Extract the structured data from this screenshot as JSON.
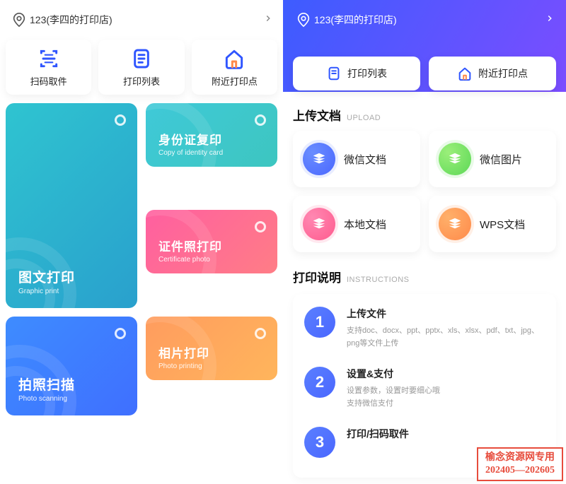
{
  "location": {
    "text": "123(李四的打印店)"
  },
  "left": {
    "actions": [
      {
        "label": "扫码取件"
      },
      {
        "label": "打印列表"
      },
      {
        "label": "附近打印点"
      }
    ],
    "tiles": {
      "graphic": {
        "title": "图文打印",
        "en": "Graphic print"
      },
      "id": {
        "title": "身份证复印",
        "en": "Copy of identity card"
      },
      "cert": {
        "title": "证件照打印",
        "en": "Certificate photo"
      },
      "scan": {
        "title": "拍照扫描",
        "en": "Photo scanning"
      },
      "photo": {
        "title": "相片打印",
        "en": "Photo printing"
      }
    }
  },
  "right": {
    "actions": [
      {
        "label": "打印列表"
      },
      {
        "label": "附近打印点"
      }
    ],
    "upload": {
      "heading_cn": "上传文档",
      "heading_en": "UPLOAD",
      "items": [
        {
          "label": "微信文档"
        },
        {
          "label": "微信图片"
        },
        {
          "label": "本地文档"
        },
        {
          "label": "WPS文档"
        }
      ]
    },
    "instructions": {
      "heading_cn": "打印说明",
      "heading_en": "INSTRUCTIONS",
      "steps": [
        {
          "num": "1",
          "title": "上传文件",
          "desc": "支持doc、docx、ppt、pptx、xls、xlsx、pdf、txt、jpg、png等文件上传"
        },
        {
          "num": "2",
          "title": "设置&支付",
          "desc": "设置参数，设置时要细心哦\n支持微信支付"
        },
        {
          "num": "3",
          "title": "打印/扫码取件",
          "desc": ""
        }
      ]
    }
  },
  "watermark": {
    "line1": "榆念资源网专用",
    "line2": "202405—202605"
  }
}
